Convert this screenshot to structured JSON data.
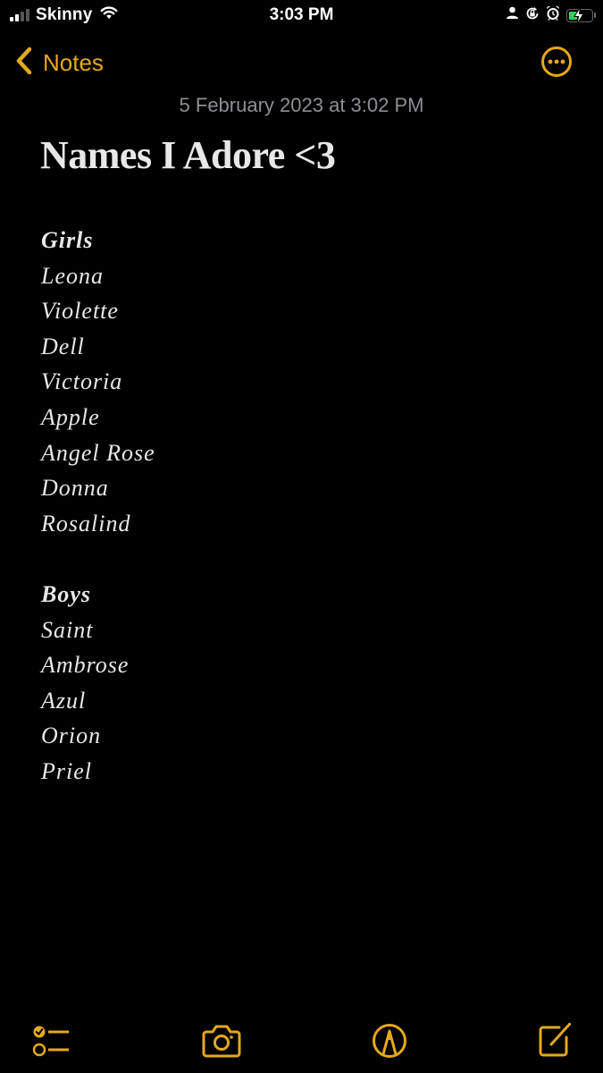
{
  "status_bar": {
    "carrier": "Skinny",
    "time": "3:03 PM",
    "signal_bars_active": 2,
    "signal_bars_total": 4,
    "battery_charging": true,
    "icons": [
      "signal-icon",
      "wifi-icon",
      "person-icon",
      "orientation-lock-icon",
      "alarm-icon",
      "battery-charging-icon"
    ]
  },
  "nav": {
    "back_label": "Notes",
    "back_icon": "chevron-left-icon",
    "more_icon": "ellipsis-circle-icon"
  },
  "note": {
    "date": "5 February 2023 at 3:02 PM",
    "title": "Names I Adore <3",
    "sections": [
      {
        "heading": "Girls",
        "names": [
          "Leona",
          "Violette",
          "Dell",
          "Victoria",
          "Apple",
          "Angel Rose",
          "Donna",
          "Rosalind"
        ]
      },
      {
        "heading": "Boys",
        "names": [
          "Saint",
          "Ambrose",
          "Azul",
          "Orion",
          "Priel"
        ]
      }
    ]
  },
  "toolbar": {
    "items": [
      {
        "name": "checklist",
        "icon": "checklist-icon"
      },
      {
        "name": "camera",
        "icon": "camera-icon"
      },
      {
        "name": "markup",
        "icon": "markup-pen-icon"
      },
      {
        "name": "compose",
        "icon": "compose-icon"
      }
    ]
  },
  "colors": {
    "accent": "#e5a91c",
    "background": "#000000",
    "text": "#e8e8e8",
    "secondary_text": "#8e8e93",
    "battery_fill": "#30d158"
  }
}
